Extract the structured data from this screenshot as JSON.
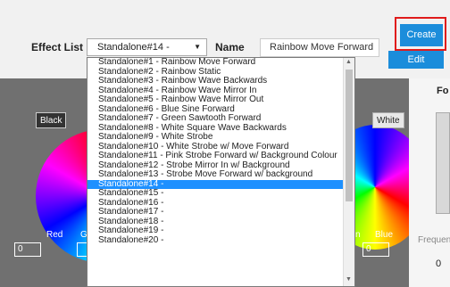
{
  "toolbar": {
    "effect_list_label": "Effect List",
    "selected_effect": "Standalone#14 -",
    "name_label": "Name",
    "name_value": "Rainbow Move Forward",
    "create_label": "Create",
    "edit_label": "Edit"
  },
  "panel": {
    "black_label": "Black",
    "white_label": "White",
    "red_label": "Red",
    "green_label_partial": "G",
    "blue_label": "Blue",
    "n_label_partial": "n",
    "red_value": "0",
    "blue_value": "0",
    "right_header_partial": "Fo",
    "frequency_partial": "Frequen",
    "frequency_value": "0"
  },
  "dropdown": {
    "items": [
      "Standalone#1 - Rainbow Move Forward",
      "Standalone#2 - Rainbow Static",
      "Standalone#3 - Rainbow Wave Backwards",
      "Standalone#4 - Rainbow Wave Mirror In",
      "Standalone#5 - Rainbow Wave Mirror Out",
      "Standalone#6 - Blue Sine Forward",
      "Standalone#7 - Green Sawtooth Forward",
      "Standalone#8 - White Square Wave Backwards",
      "Standalone#9 - White Strobe",
      "Standalone#10 - White Strobe w/ Move Forward",
      "Standalone#11 - Pink Strobe Forward w/ Background Colour",
      "Standalone#12 - Strobe Mirror In w/ Background",
      "Standalone#13 - Strobe Move Forward w/ background",
      "Standalone#14 -",
      "Standalone#15 -",
      "Standalone#16 -",
      "Standalone#17 -",
      "Standalone#18 -",
      "Standalone#19 -",
      "Standalone#20 -"
    ],
    "selected_index": 13
  },
  "colors": {
    "accent": "#1b8ddb",
    "highlight": "#e01b1b",
    "selection": "#1e90ff"
  }
}
